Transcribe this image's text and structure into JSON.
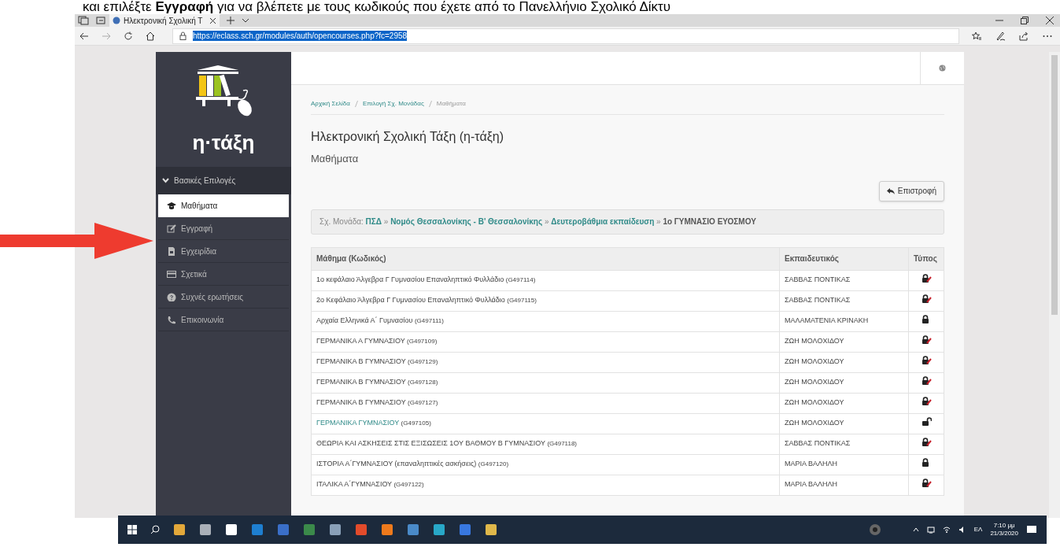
{
  "document_text": "και επιλέξτε **Εγγραφή** για να βλέπετε με τους κωδικούς που έχετε από το Πανελλήνιο Σχολικό Δίκτυ",
  "browser": {
    "tabs": [
      {
        "title": "Ηλεκτρονική Σχολική Τ",
        "selected": true
      }
    ],
    "url": "https://eclass.sch.gr/modules/auth/opencourses.php?fc=2958"
  },
  "sidebar": {
    "logo_text": "η·τάξη",
    "section": "Βασικές Επιλογές",
    "items": [
      {
        "label": "Μαθήματα",
        "selected": true
      },
      {
        "label": "Εγγραφή",
        "selected": false
      },
      {
        "label": "Εγχειρίδια",
        "selected": false
      },
      {
        "label": "Σχετικά",
        "selected": false
      },
      {
        "label": "Συχνές ερωτήσεις",
        "selected": false
      },
      {
        "label": "Επικοινωνία",
        "selected": false
      }
    ]
  },
  "breadcrumb": [
    {
      "label": "Αρχική Σελίδα",
      "link": true
    },
    {
      "label": "Επιλογή Σχ. Μονάδας",
      "link": true
    },
    {
      "label": "Μαθήματα",
      "link": false
    }
  ],
  "title": "Ηλεκτρονική Σχολική Τάξη (η-τάξη)",
  "subtitle": "Μαθήματα",
  "back_button": "Επιστροφή",
  "school_path": "Σχ. Μονάδα: **ΠΣΔ** » **Νομός Θεσσαλονίκης - Β' Θεσσαλονίκης** » **Δευτεροβάθμια εκπαίδευση** » **1ο ΓΥΜΝΑΣΙΟ ΕΥΟΣΜΟΥ**",
  "table": {
    "columns": [
      "Μάθημα (Κωδικός)",
      "Εκπαιδευτικός",
      "Τύπος"
    ],
    "rows": [
      {
        "course": "1ο κεφάλαιο Άλγεβρα Γ Γυμνασίου Επαναληπτικό Φυλλάδιο",
        "code": "(G497114)",
        "teacher": "ΣΑΒΒΑΣ ΠΟΝΤΙΚΑΣ",
        "kind": "lock-edit",
        "linked": false
      },
      {
        "course": "2ο Κεφάλαιο Άλγεβρα Γ Γυμνασίου Επαναληπτικό Φυλλάδιο",
        "code": "(G497115)",
        "teacher": "ΣΑΒΒΑΣ ΠΟΝΤΙΚΑΣ",
        "kind": "lock-edit",
        "linked": false
      },
      {
        "course": "Αρχαία Ελληνικά Α΄ Γυμνασίου",
        "code": "(G497111)",
        "teacher": "ΜΑΛΑΜΑΤΕΝΙΑ ΚΡΙΝΑΚΗ",
        "kind": "lock",
        "linked": false
      },
      {
        "course": "ΓΕΡΜΑΝΙΚΑ Α ΓΥΜΝΑΣΙΟΥ",
        "code": "(G497109)",
        "teacher": "ΖΩΗ ΜΟΛΟΧΙΔΟΥ",
        "kind": "lock-edit",
        "linked": false
      },
      {
        "course": "ΓΕΡΜΑΝΙΚΑ Β ΓΥΜΝΑΣΙΟΥ",
        "code": "(G497129)",
        "teacher": "ΖΩΗ ΜΟΛΟΧΙΔΟΥ",
        "kind": "lock-edit",
        "linked": false
      },
      {
        "course": "ΓΕΡΜΑΝΙΚΑ Β ΓΥΜΝΑΣΙΟΥ",
        "code": "(G497128)",
        "teacher": "ΖΩΗ ΜΟΛΟΧΙΔΟΥ",
        "kind": "lock-edit",
        "linked": false
      },
      {
        "course": "ΓΕΡΜΑΝΙΚΑ Β ΓΥΜΝΑΣΙΟΥ",
        "code": "(G497127)",
        "teacher": "ΖΩΗ ΜΟΛΟΧΙΔΟΥ",
        "kind": "lock-edit",
        "linked": false
      },
      {
        "course": "ΓΕΡΜΑΝΙΚΑ ΓΥΜΝΑΣΙΟΥ",
        "code": "(G497105)",
        "teacher": "ΖΩΗ ΜΟΛΟΧΙΔΟΥ",
        "kind": "unlock",
        "linked": true
      },
      {
        "course": "ΘΕΩΡΙΑ ΚΑΙ ΑΣΚΗΣΕΙΣ ΣΤΙΣ ΕΞΙΣΩΣΕΙΣ 1ΟΥ ΒΑΘΜΟΥ Β ΓΥΜΝΑΣΙΟΥ",
        "code": "(G497118)",
        "teacher": "ΣΑΒΒΑΣ ΠΟΝΤΙΚΑΣ",
        "kind": "lock-edit",
        "linked": false
      },
      {
        "course": "ΙΣΤΟΡΙΑ Α΄ΓΥΜΝΑΣΙΟΥ (επαναληπτικές ασκήσεις)",
        "code": "(G497120)",
        "teacher": "ΜΑΡΙΑ ΒΑΛΗΛΗ",
        "kind": "lock",
        "linked": false
      },
      {
        "course": "ΙΤΑΛΙΚΑ Α΄ΓΥΜΝΑΣΙΟΥ",
        "code": "(G497122)",
        "teacher": "ΜΑΡΙΑ ΒΑΛΗΛΗ",
        "kind": "lock-edit",
        "linked": false
      }
    ]
  },
  "taskbar": {
    "language": "ΕΛ",
    "time": "7:10 μμ",
    "date": "21/3/2020"
  }
}
